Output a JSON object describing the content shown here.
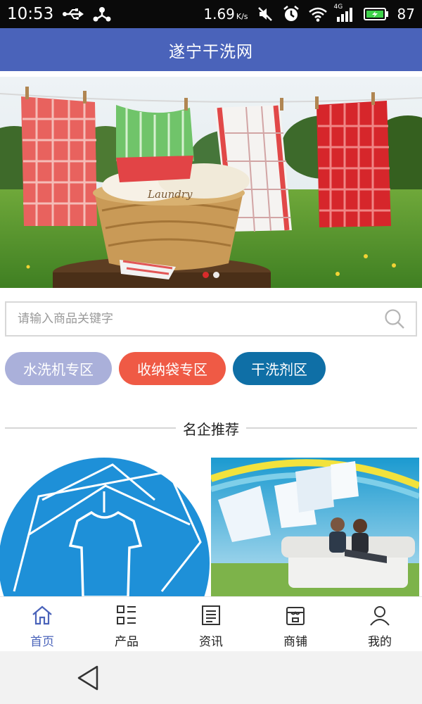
{
  "status_bar": {
    "time": "10:53",
    "net_speed": "1.69",
    "net_unit": "K/s",
    "network_label": "4G",
    "battery": "87",
    "icons": [
      "usb-icon",
      "share-icon",
      "mute-icon",
      "alarm-icon",
      "wifi-icon",
      "signal-icon",
      "battery-icon"
    ]
  },
  "header": {
    "title": "遂宁干洗网"
  },
  "banner": {
    "slides": 2,
    "active_slide": 1,
    "basket_text": "Laundry"
  },
  "search": {
    "placeholder": "请输入商品关键字",
    "value": ""
  },
  "categories": [
    {
      "label": "水洗机专区",
      "color": "#aab0da"
    },
    {
      "label": "收纳袋专区",
      "color": "#ef5a45"
    },
    {
      "label": "干洗剂区",
      "color": "#0f6fa6"
    }
  ],
  "section": {
    "title": "名企推荐"
  },
  "tab_bar": {
    "items": [
      {
        "label": "首页",
        "icon": "home-icon",
        "active": true
      },
      {
        "label": "产品",
        "icon": "grid-list-icon",
        "active": false
      },
      {
        "label": "资讯",
        "icon": "news-icon",
        "active": false
      },
      {
        "label": "商铺",
        "icon": "shop-icon",
        "active": false
      },
      {
        "label": "我的",
        "icon": "user-icon",
        "active": false
      }
    ]
  },
  "colors": {
    "header_bg": "#4a63ba",
    "active_tab": "#4a63ba",
    "status_bar_bg": "#0a0a0a"
  }
}
